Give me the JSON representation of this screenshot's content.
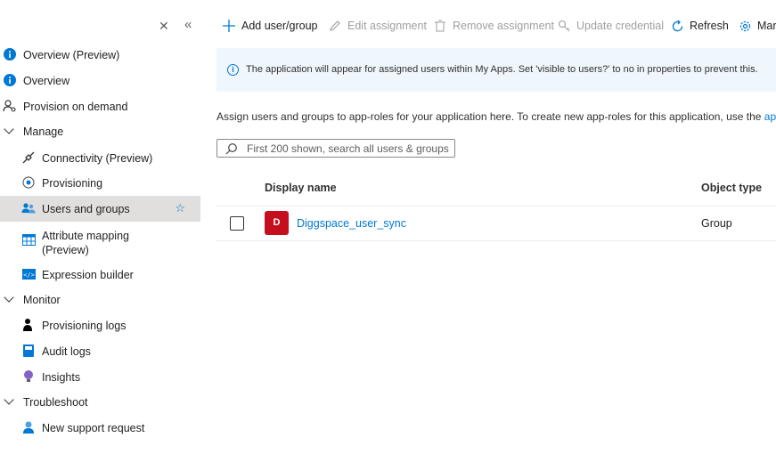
{
  "sidebar": {
    "items": [
      {
        "label": "Overview (Preview)",
        "icon": "info-icon"
      },
      {
        "label": "Overview",
        "icon": "info-icon"
      },
      {
        "label": "Provision on demand",
        "icon": "person-key-icon"
      },
      {
        "label": "Manage",
        "icon": "chevron-down-icon"
      },
      {
        "label": "Connectivity (Preview)",
        "icon": "plug-icon"
      },
      {
        "label": "Provisioning",
        "icon": "provisioning-icon"
      },
      {
        "label": "Users and groups",
        "icon": "users-icon"
      },
      {
        "label": "Attribute mapping (Preview)",
        "icon": "table-icon"
      },
      {
        "label": "Expression builder",
        "icon": "code-icon"
      },
      {
        "label": "Monitor",
        "icon": "chevron-down-icon"
      },
      {
        "label": "Provisioning logs",
        "icon": "person-log-icon"
      },
      {
        "label": "Audit logs",
        "icon": "book-icon"
      },
      {
        "label": "Insights",
        "icon": "lightbulb-icon"
      },
      {
        "label": "Troubleshoot",
        "icon": "chevron-down-icon"
      },
      {
        "label": "New support request",
        "icon": "support-person-icon"
      }
    ]
  },
  "toolbar": {
    "add": "Add user/group",
    "edit": "Edit assignment",
    "remove": "Remove assignment",
    "update": "Update credential",
    "refresh": "Refresh",
    "manage": "Mar"
  },
  "banner": {
    "text": "The application will appear for assigned users within My Apps. Set 'visible to users?' to no in properties to prevent this."
  },
  "description": {
    "text": "Assign users and groups to app-roles for your application here. To create new app-roles for this application, use the ",
    "link": "applic"
  },
  "search": {
    "placeholder": "First 200 shown, search all users & groups"
  },
  "table": {
    "headers": [
      "Display name",
      "Object type"
    ],
    "rows": [
      {
        "initial": "D",
        "name": "Diggspace_user_sync",
        "type": "Group"
      }
    ]
  },
  "colors": {
    "accent": "#0078d4",
    "avatar": "#c50f1f",
    "selected": "#e1dfdd",
    "banner": "#eff6fc"
  }
}
